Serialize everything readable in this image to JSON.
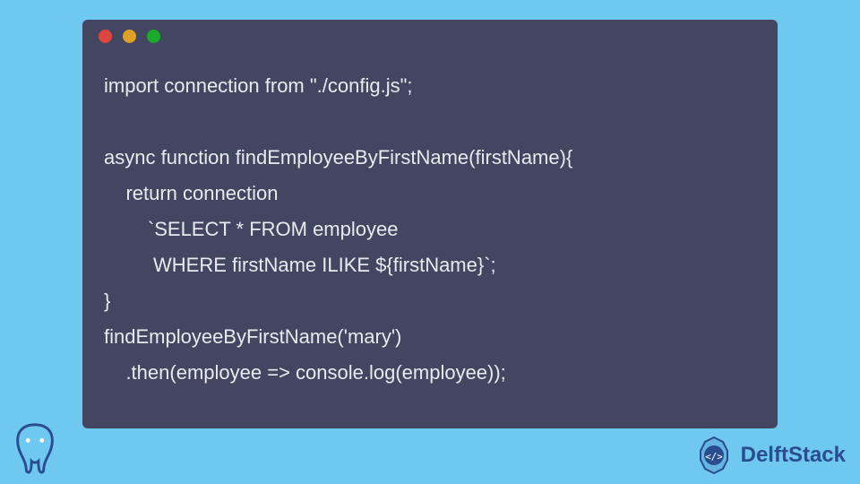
{
  "code": {
    "lines": [
      "import connection from \"./config.js\";",
      "",
      "async function findEmployeeByFirstName(firstName){",
      "    return connection",
      "        `SELECT * FROM employee",
      "         WHERE firstName ILIKE ${firstName}`;",
      "}",
      "findEmployeeByFirstName('mary')",
      "    .then(employee => console.log(employee));"
    ]
  },
  "branding": {
    "delftstack": "DelftStack"
  },
  "colors": {
    "page_bg": "#6fc8f0",
    "code_bg": "#434660",
    "code_fg": "#e8eaf0",
    "dot_red": "#e0443e",
    "dot_yellow": "#dea123",
    "dot_green": "#1aab29",
    "delft_text": "#2a4d8f"
  }
}
